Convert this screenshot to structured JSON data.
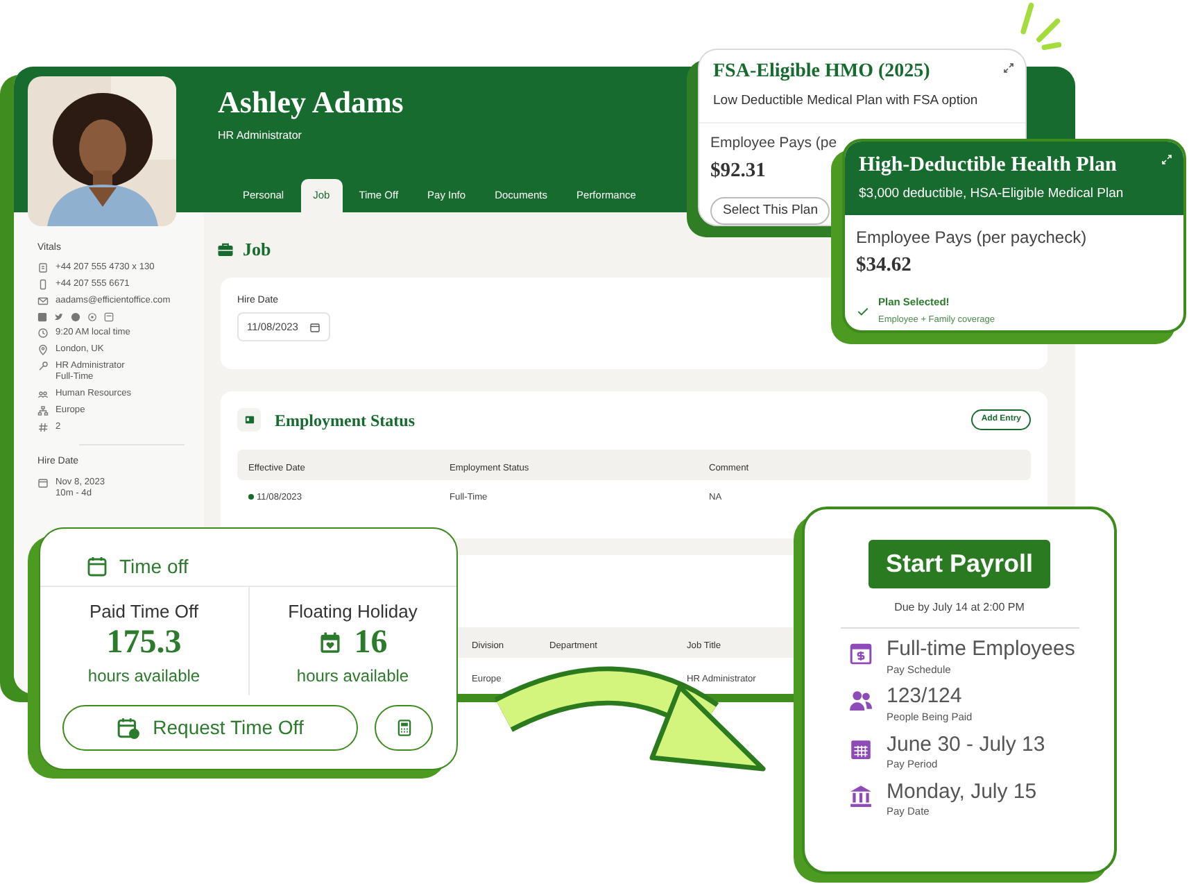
{
  "profile": {
    "name": "Ashley Adams",
    "role": "HR Administrator"
  },
  "tabs": [
    {
      "label": "Personal",
      "selected": false
    },
    {
      "label": "Job",
      "selected": true
    },
    {
      "label": "Time Off",
      "selected": false
    },
    {
      "label": "Pay Info",
      "selected": false
    },
    {
      "label": "Documents",
      "selected": false
    },
    {
      "label": "Performance",
      "selected": false
    }
  ],
  "sidebar": {
    "title": "Vitals",
    "items": [
      {
        "lines": [
          "+44 207 555 4730 x 130"
        ]
      },
      {
        "lines": [
          "+44 207 555 6671"
        ]
      },
      {
        "lines": [
          "aadams@efficientoffice.com"
        ]
      },
      {
        "lines": [
          "9:20 AM local time"
        ]
      },
      {
        "lines": [
          "London, UK"
        ]
      },
      {
        "lines": [
          "HR Administrator",
          "Full-Time"
        ]
      },
      {
        "lines": [
          "Human Resources"
        ]
      },
      {
        "lines": [
          "Europe"
        ]
      },
      {
        "lines": [
          "2"
        ]
      }
    ],
    "hire_date": {
      "title": "Hire Date",
      "date": "Nov 8, 2023",
      "tenure": "10m - 4d"
    }
  },
  "job": {
    "title": "Job",
    "hire_date_label": "Hire Date",
    "hire_date_value": "11/08/2023"
  },
  "employment_status": {
    "title": "Employment Status",
    "add_button": "Add Entry",
    "columns": [
      "Effective Date",
      "Employment Status",
      "Comment"
    ],
    "rows": [
      {
        "cells": [
          "11/08/2023",
          "Full-Time",
          "NA"
        ],
        "current": true
      }
    ]
  },
  "job_information": {
    "columns": [
      "Division",
      "Department",
      "Job Title"
    ],
    "rows": [
      {
        "division": "Europe",
        "job_title": "HR Administrator"
      }
    ]
  },
  "plans": [
    {
      "title": "FSA-Eligible HMO (2025)",
      "subtitle": "Low Deductible Medical Plan with FSA option",
      "pays_label": "Employee Pays (pe",
      "amount": "$92.31",
      "button": "Select This Plan",
      "selected": false
    },
    {
      "title": "High-Deductible Health Plan",
      "subtitle": "$3,000 deductible, HSA-Eligible Medical Plan",
      "pays_label": "Employee Pays (per paycheck)",
      "amount": "$34.62",
      "status": "Plan Selected!",
      "status_note": "Employee + Family coverage",
      "selected": true
    }
  ],
  "time_off": {
    "title": "Time off",
    "balances": [
      {
        "label": "Paid Time Off",
        "value": "175.3",
        "unit": "hours available",
        "kind": "hours"
      },
      {
        "label": "Floating Holiday",
        "value": "16",
        "unit": "hours available",
        "kind": "holiday"
      }
    ],
    "request_button": "Request Time Off"
  },
  "payroll": {
    "button": "Start Payroll",
    "due": "Due by July 14 at 2:00 PM",
    "items": [
      {
        "value": "Full-time Employees",
        "label": "Pay Schedule"
      },
      {
        "value": "123/124",
        "label": "People Being Paid"
      },
      {
        "value": "June 30 - July 13",
        "label": "Pay Period"
      },
      {
        "value": "Monday, July 15",
        "label": "Pay Date"
      }
    ]
  }
}
